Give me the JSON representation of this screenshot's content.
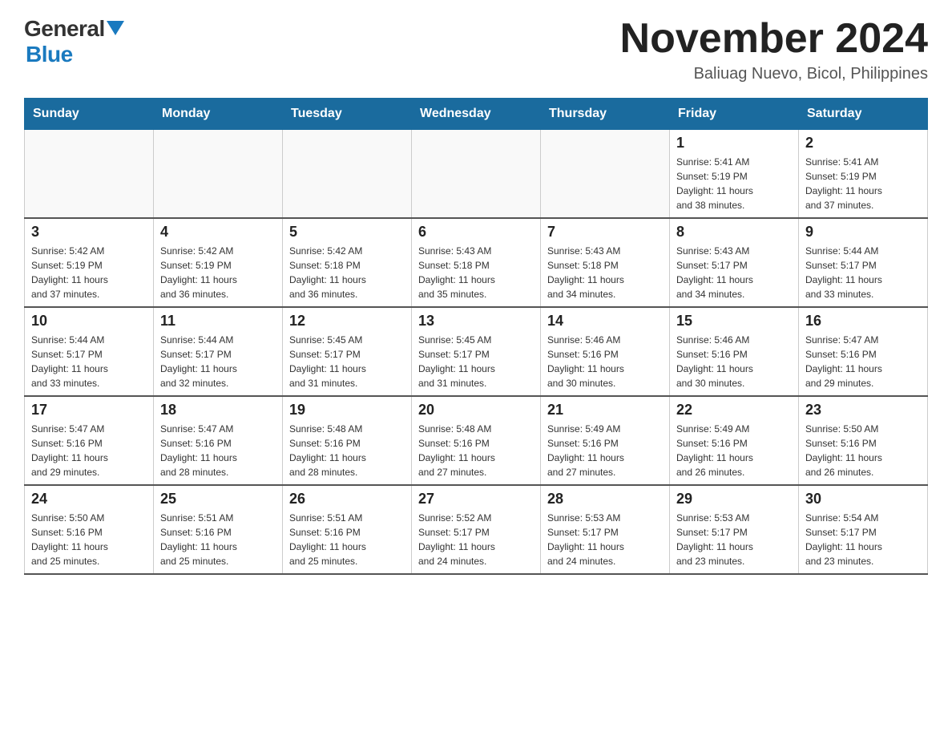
{
  "header": {
    "logo_general": "General",
    "logo_blue": "Blue",
    "main_title": "November 2024",
    "subtitle": "Baliuag Nuevo, Bicol, Philippines"
  },
  "weekdays": [
    "Sunday",
    "Monday",
    "Tuesday",
    "Wednesday",
    "Thursday",
    "Friday",
    "Saturday"
  ],
  "weeks": [
    [
      {
        "day": "",
        "info": ""
      },
      {
        "day": "",
        "info": ""
      },
      {
        "day": "",
        "info": ""
      },
      {
        "day": "",
        "info": ""
      },
      {
        "day": "",
        "info": ""
      },
      {
        "day": "1",
        "info": "Sunrise: 5:41 AM\nSunset: 5:19 PM\nDaylight: 11 hours\nand 38 minutes."
      },
      {
        "day": "2",
        "info": "Sunrise: 5:41 AM\nSunset: 5:19 PM\nDaylight: 11 hours\nand 37 minutes."
      }
    ],
    [
      {
        "day": "3",
        "info": "Sunrise: 5:42 AM\nSunset: 5:19 PM\nDaylight: 11 hours\nand 37 minutes."
      },
      {
        "day": "4",
        "info": "Sunrise: 5:42 AM\nSunset: 5:19 PM\nDaylight: 11 hours\nand 36 minutes."
      },
      {
        "day": "5",
        "info": "Sunrise: 5:42 AM\nSunset: 5:18 PM\nDaylight: 11 hours\nand 36 minutes."
      },
      {
        "day": "6",
        "info": "Sunrise: 5:43 AM\nSunset: 5:18 PM\nDaylight: 11 hours\nand 35 minutes."
      },
      {
        "day": "7",
        "info": "Sunrise: 5:43 AM\nSunset: 5:18 PM\nDaylight: 11 hours\nand 34 minutes."
      },
      {
        "day": "8",
        "info": "Sunrise: 5:43 AM\nSunset: 5:17 PM\nDaylight: 11 hours\nand 34 minutes."
      },
      {
        "day": "9",
        "info": "Sunrise: 5:44 AM\nSunset: 5:17 PM\nDaylight: 11 hours\nand 33 minutes."
      }
    ],
    [
      {
        "day": "10",
        "info": "Sunrise: 5:44 AM\nSunset: 5:17 PM\nDaylight: 11 hours\nand 33 minutes."
      },
      {
        "day": "11",
        "info": "Sunrise: 5:44 AM\nSunset: 5:17 PM\nDaylight: 11 hours\nand 32 minutes."
      },
      {
        "day": "12",
        "info": "Sunrise: 5:45 AM\nSunset: 5:17 PM\nDaylight: 11 hours\nand 31 minutes."
      },
      {
        "day": "13",
        "info": "Sunrise: 5:45 AM\nSunset: 5:17 PM\nDaylight: 11 hours\nand 31 minutes."
      },
      {
        "day": "14",
        "info": "Sunrise: 5:46 AM\nSunset: 5:16 PM\nDaylight: 11 hours\nand 30 minutes."
      },
      {
        "day": "15",
        "info": "Sunrise: 5:46 AM\nSunset: 5:16 PM\nDaylight: 11 hours\nand 30 minutes."
      },
      {
        "day": "16",
        "info": "Sunrise: 5:47 AM\nSunset: 5:16 PM\nDaylight: 11 hours\nand 29 minutes."
      }
    ],
    [
      {
        "day": "17",
        "info": "Sunrise: 5:47 AM\nSunset: 5:16 PM\nDaylight: 11 hours\nand 29 minutes."
      },
      {
        "day": "18",
        "info": "Sunrise: 5:47 AM\nSunset: 5:16 PM\nDaylight: 11 hours\nand 28 minutes."
      },
      {
        "day": "19",
        "info": "Sunrise: 5:48 AM\nSunset: 5:16 PM\nDaylight: 11 hours\nand 28 minutes."
      },
      {
        "day": "20",
        "info": "Sunrise: 5:48 AM\nSunset: 5:16 PM\nDaylight: 11 hours\nand 27 minutes."
      },
      {
        "day": "21",
        "info": "Sunrise: 5:49 AM\nSunset: 5:16 PM\nDaylight: 11 hours\nand 27 minutes."
      },
      {
        "day": "22",
        "info": "Sunrise: 5:49 AM\nSunset: 5:16 PM\nDaylight: 11 hours\nand 26 minutes."
      },
      {
        "day": "23",
        "info": "Sunrise: 5:50 AM\nSunset: 5:16 PM\nDaylight: 11 hours\nand 26 minutes."
      }
    ],
    [
      {
        "day": "24",
        "info": "Sunrise: 5:50 AM\nSunset: 5:16 PM\nDaylight: 11 hours\nand 25 minutes."
      },
      {
        "day": "25",
        "info": "Sunrise: 5:51 AM\nSunset: 5:16 PM\nDaylight: 11 hours\nand 25 minutes."
      },
      {
        "day": "26",
        "info": "Sunrise: 5:51 AM\nSunset: 5:16 PM\nDaylight: 11 hours\nand 25 minutes."
      },
      {
        "day": "27",
        "info": "Sunrise: 5:52 AM\nSunset: 5:17 PM\nDaylight: 11 hours\nand 24 minutes."
      },
      {
        "day": "28",
        "info": "Sunrise: 5:53 AM\nSunset: 5:17 PM\nDaylight: 11 hours\nand 24 minutes."
      },
      {
        "day": "29",
        "info": "Sunrise: 5:53 AM\nSunset: 5:17 PM\nDaylight: 11 hours\nand 23 minutes."
      },
      {
        "day": "30",
        "info": "Sunrise: 5:54 AM\nSunset: 5:17 PM\nDaylight: 11 hours\nand 23 minutes."
      }
    ]
  ]
}
